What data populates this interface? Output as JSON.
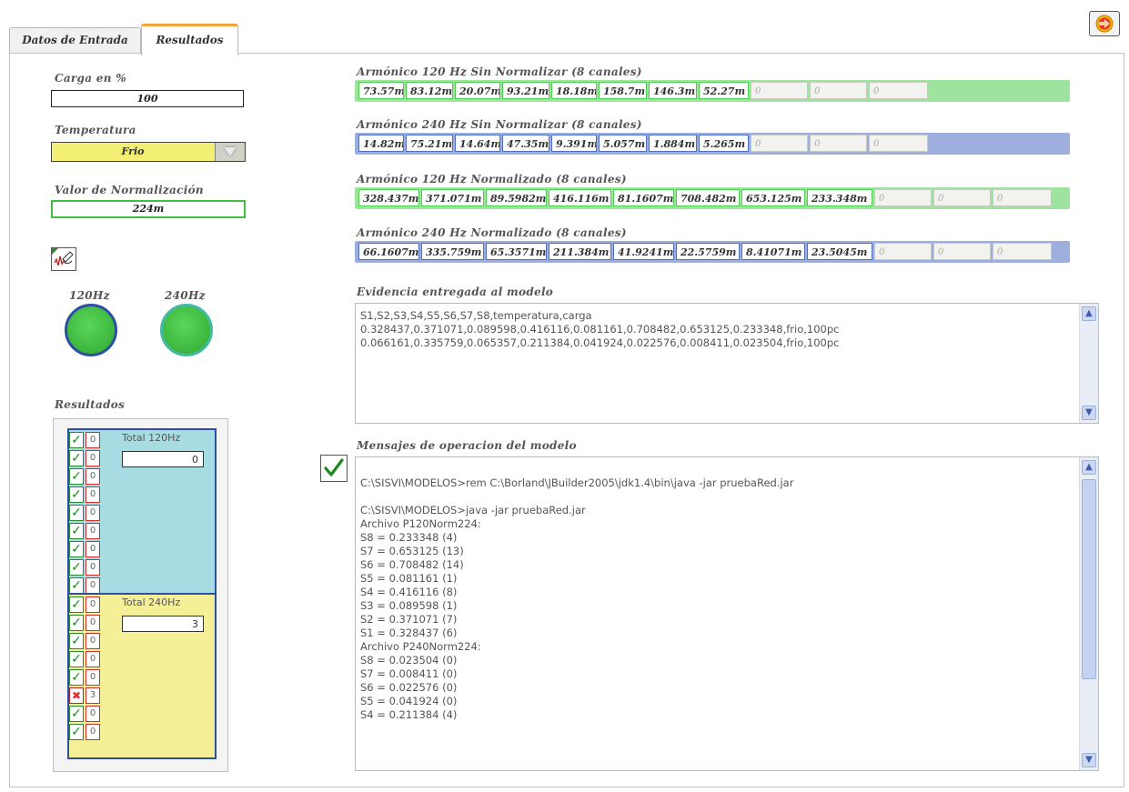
{
  "tabs": [
    {
      "label": "Datos de Entrada",
      "active": false
    },
    {
      "label": "Resultados",
      "active": true
    }
  ],
  "left": {
    "carga_label": "Carga en %",
    "carga_value": "100",
    "temperatura_label": "Temperatura",
    "temperatura_value": "Frio",
    "normalizacion_label": "Valor de Normalización",
    "normalizacion_value": "224m",
    "led_labels": [
      "120Hz",
      "240Hz"
    ],
    "resultados_label": "Resultados"
  },
  "harmonics": [
    {
      "title": "Armónico 120 Hz Sin Normalizar (8 canales)",
      "frame_color": "#4fcf4f",
      "values": [
        "73.57m",
        "83.12m",
        "20.07m",
        "93.21m",
        "18.18m",
        "158.7m",
        "146.3m",
        "52.27m",
        "0",
        "0",
        "0"
      ]
    },
    {
      "title": "Armónico 240 Hz Sin Normalizar (8 canales)",
      "frame_color": "#4f6fc2",
      "values": [
        "14.82m",
        "75.21m",
        "14.64m",
        "47.35m",
        "9.391m",
        "5.057m",
        "1.884m",
        "5.265m",
        "0",
        "0",
        "0"
      ]
    },
    {
      "title": "Armónico 120 Hz Normalizado (8 canales)",
      "frame_color": "#4fcf4f",
      "values": [
        "328.437m",
        "371.071m",
        "89.5982m",
        "416.116m",
        "81.1607m",
        "708.482m",
        "653.125m",
        "233.348m",
        "0",
        "0",
        "0"
      ]
    },
    {
      "title": "Armónico 240 Hz Normalizado (8 canales)",
      "frame_color": "#4f6fc2",
      "values": [
        "66.1607m",
        "335.759m",
        "65.3571m",
        "211.384m",
        "41.9241m",
        "22.5759m",
        "8.41071m",
        "23.5045m",
        "0",
        "0",
        "0"
      ]
    }
  ],
  "evidencia": {
    "title": "Evidencia entregada al modelo",
    "lines": [
      "S1,S2,S3,S4,S5,S6,S7,S8,temperatura,carga",
      "0.328437,0.371071,0.089598,0.416116,0.081161,0.708482,0.653125,0.233348,frio,100pc",
      "0.066161,0.335759,0.065357,0.211384,0.041924,0.022576,0.008411,0.023504,frio,100pc"
    ]
  },
  "mensajes": {
    "title": "Mensajes de operacion del modelo",
    "lines": [
      "",
      "C:\\SISVI\\MODELOS>rem C:\\Borland\\JBuilder2005\\jdk1.4\\bin\\java -jar pruebaRed.jar",
      "",
      "C:\\SISVI\\MODELOS>java -jar pruebaRed.jar",
      "Archivo P120Norm224:",
      "S8 = 0.233348 (4)",
      "S7 = 0.653125 (13)",
      "S6 = 0.708482 (14)",
      "S5 = 0.081161 (1)",
      "S4 = 0.416116 (8)",
      "S3 = 0.089598 (1)",
      "S2 = 0.371071 (7)",
      "S1 = 0.328437 (6)",
      "Archivo P240Norm224:",
      "S8 = 0.023504 (0)",
      "S7 = 0.008411 (0)",
      "S6 = 0.022576 (0)",
      "S5 = 0.041924 (0)",
      "S4 = 0.211384 (4)"
    ]
  },
  "results": {
    "group120": {
      "total_label": "Total 120Hz",
      "total_value": "0",
      "rows": [
        {
          "ok": true,
          "count": "0"
        },
        {
          "ok": true,
          "count": "0"
        },
        {
          "ok": true,
          "count": "0"
        },
        {
          "ok": true,
          "count": "0"
        },
        {
          "ok": true,
          "count": "0"
        },
        {
          "ok": true,
          "count": "0"
        },
        {
          "ok": true,
          "count": "0"
        },
        {
          "ok": true,
          "count": "0"
        },
        {
          "ok": true,
          "count": "0"
        }
      ]
    },
    "group240": {
      "total_label": "Total 240Hz",
      "total_value": "3",
      "rows": [
        {
          "ok": true,
          "count": "0"
        },
        {
          "ok": true,
          "count": "0"
        },
        {
          "ok": true,
          "count": "0"
        },
        {
          "ok": true,
          "count": "0"
        },
        {
          "ok": true,
          "count": "0"
        },
        {
          "ok": false,
          "count": "3"
        },
        {
          "ok": true,
          "count": "0"
        },
        {
          "ok": true,
          "count": "0"
        }
      ]
    }
  },
  "icons": {
    "exit": "exit-arrow-icon",
    "signal_edit": "signal-edit-icon",
    "ok": "checkmark-icon"
  },
  "colors": {
    "tab_accent": "#f2a33a",
    "led_on": "#3fbf3f",
    "group120_bg": "#a8dce3",
    "group240_bg": "#f5f098",
    "dropdown_bg": "#f3ee74"
  }
}
